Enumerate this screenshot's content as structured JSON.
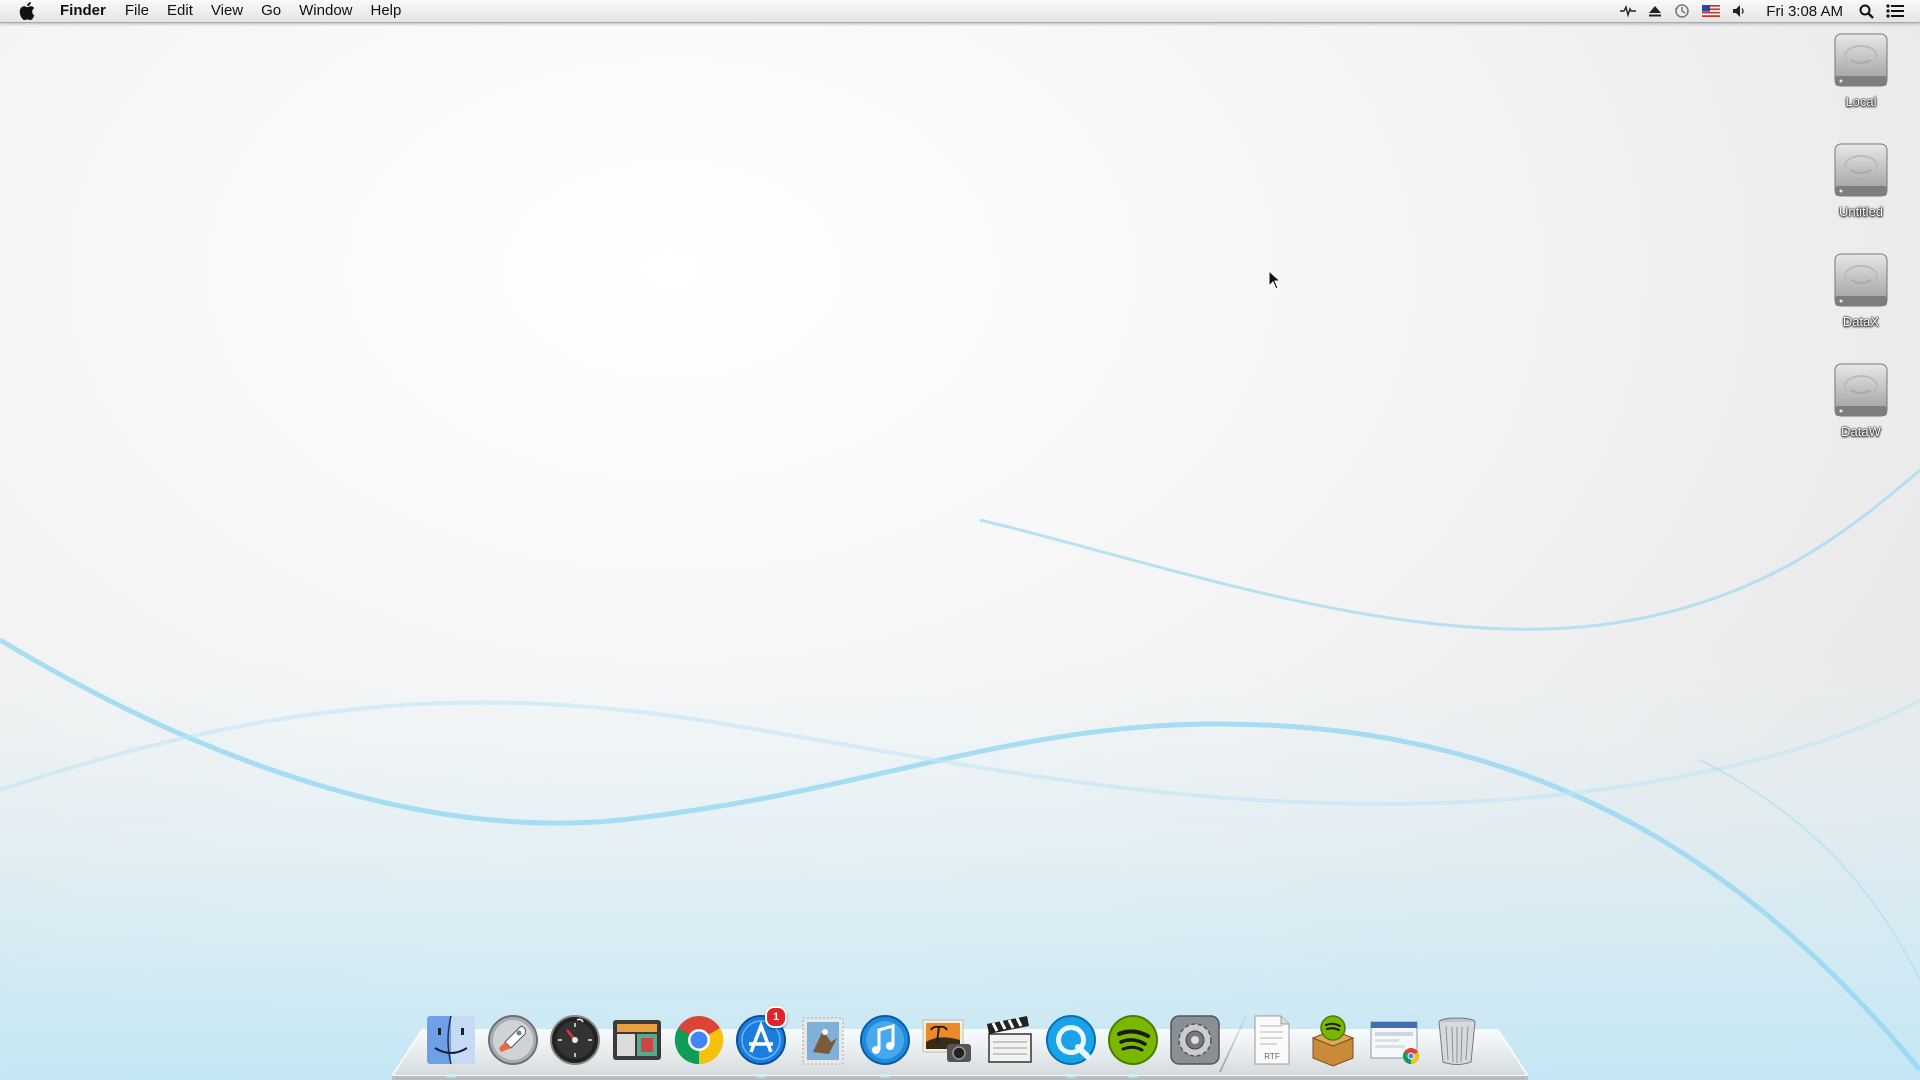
{
  "menubar": {
    "apple_icon": "apple-icon",
    "app_name": "Finder",
    "menus": [
      "File",
      "Edit",
      "View",
      "Go",
      "Window",
      "Help"
    ],
    "status_icons": [
      "activity-icon",
      "eject-icon",
      "time-machine-icon",
      "us-flag-icon",
      "volume-icon"
    ],
    "clock": "Fri 3:08 AM",
    "search_icon": "spotlight-search-icon",
    "notification_icon": "notification-center-icon"
  },
  "desktop": {
    "drives": [
      {
        "label": "Local",
        "icon": "hard-drive-icon"
      },
      {
        "label": "Untitled",
        "icon": "hard-drive-icon"
      },
      {
        "label": "DataX",
        "icon": "hard-drive-icon"
      },
      {
        "label": "DataW",
        "icon": "hard-drive-icon"
      }
    ]
  },
  "dock": {
    "apps": [
      {
        "name": "finder",
        "icon": "finder-icon",
        "running": true
      },
      {
        "name": "launchpad",
        "icon": "launchpad-rocket-icon",
        "running": false
      },
      {
        "name": "dashboard",
        "icon": "dashboard-icon",
        "running": false
      },
      {
        "name": "image-capture",
        "icon": "photo-booth-icon",
        "running": false
      },
      {
        "name": "chrome",
        "icon": "chrome-icon",
        "running": false
      },
      {
        "name": "app-store",
        "icon": "app-store-icon",
        "running": true,
        "badge": "1"
      },
      {
        "name": "mail",
        "icon": "mail-stamp-icon",
        "running": false
      },
      {
        "name": "itunes",
        "icon": "itunes-icon",
        "running": true
      },
      {
        "name": "iphoto",
        "icon": "iphoto-icon",
        "running": false
      },
      {
        "name": "imovie",
        "icon": "clapperboard-icon",
        "running": false
      },
      {
        "name": "quicktime",
        "icon": "quicktime-icon",
        "running": true
      },
      {
        "name": "spotify",
        "icon": "spotify-icon",
        "running": true
      },
      {
        "name": "system-preferences",
        "icon": "system-preferences-gear-icon",
        "running": false
      }
    ],
    "stacks": [
      {
        "name": "rtf-document",
        "icon": "rtf-document-icon",
        "label": "RTF"
      },
      {
        "name": "downloads-box",
        "icon": "spotify-installer-box-icon"
      },
      {
        "name": "chrome-window",
        "icon": "chrome-window-icon"
      },
      {
        "name": "trash",
        "icon": "trash-icon"
      }
    ]
  },
  "colors": {
    "wave": "#7fd0f0",
    "badge": "#e0242c"
  }
}
